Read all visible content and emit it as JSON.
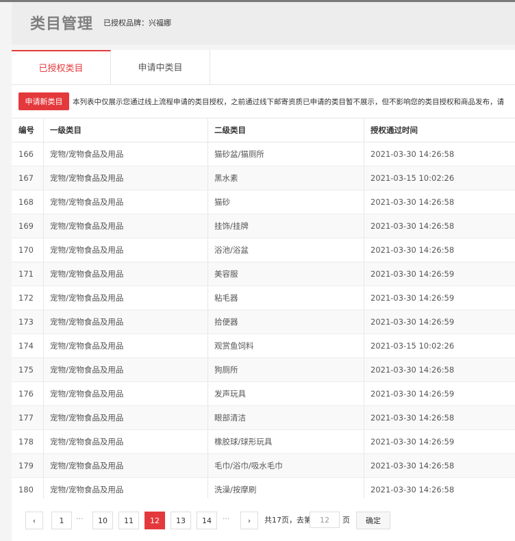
{
  "header": {
    "title": "类目管理",
    "brand_label": "已授权品牌：兴福娜"
  },
  "tabs": [
    {
      "label": "已授权类目"
    },
    {
      "label": "申请中类目"
    }
  ],
  "toolbar": {
    "apply_label": "申请新类目",
    "notice": "本列表中仅展示您通过线上流程申请的类目授权，之前通过线下邮寄资质已申请的类目暂不展示，但不影响您的类目授权和商品发布，请"
  },
  "table": {
    "headers": [
      "编号",
      "一级类目",
      "二级类目",
      "授权通过时间"
    ],
    "rows": [
      [
        "166",
        "宠物/宠物食品及用品",
        "猫砂盆/猫厕所",
        "2021-03-30 14:26:58"
      ],
      [
        "167",
        "宠物/宠物食品及用品",
        "黑水素",
        "2021-03-15 10:02:26"
      ],
      [
        "168",
        "宠物/宠物食品及用品",
        "猫砂",
        "2021-03-30 14:26:58"
      ],
      [
        "169",
        "宠物/宠物食品及用品",
        "挂饰/挂牌",
        "2021-03-30 14:26:58"
      ],
      [
        "170",
        "宠物/宠物食品及用品",
        "浴池/浴盆",
        "2021-03-30 14:26:58"
      ],
      [
        "171",
        "宠物/宠物食品及用品",
        "美容服",
        "2021-03-30 14:26:59"
      ],
      [
        "172",
        "宠物/宠物食品及用品",
        "粘毛器",
        "2021-03-30 14:26:59"
      ],
      [
        "173",
        "宠物/宠物食品及用品",
        "拾便器",
        "2021-03-30 14:26:59"
      ],
      [
        "174",
        "宠物/宠物食品及用品",
        "观赏鱼饲料",
        "2021-03-15 10:02:26"
      ],
      [
        "175",
        "宠物/宠物食品及用品",
        "狗厕所",
        "2021-03-30 14:26:58"
      ],
      [
        "176",
        "宠物/宠物食品及用品",
        "发声玩具",
        "2021-03-30 14:26:59"
      ],
      [
        "177",
        "宠物/宠物食品及用品",
        "眼部清洁",
        "2021-03-30 14:26:58"
      ],
      [
        "178",
        "宠物/宠物食品及用品",
        "橡胶球/球形玩具",
        "2021-03-30 14:26:59"
      ],
      [
        "179",
        "宠物/宠物食品及用品",
        "毛巾/浴巾/吸水毛巾",
        "2021-03-30 14:26:58"
      ],
      [
        "180",
        "宠物/宠物食品及用品",
        "洗澡/按摩刷",
        "2021-03-30 14:26:58"
      ]
    ]
  },
  "pagination": {
    "prev_icon": "‹",
    "next_icon": "›",
    "pages": [
      "1",
      "10",
      "11",
      "12",
      "13",
      "14"
    ],
    "current": "12",
    "ellipsis": "···",
    "total_text": "共17页，去第",
    "page_input_value": "12",
    "page_unit": "页",
    "confirm_label": "确定"
  },
  "colors": {
    "accent": "#e4393c"
  }
}
